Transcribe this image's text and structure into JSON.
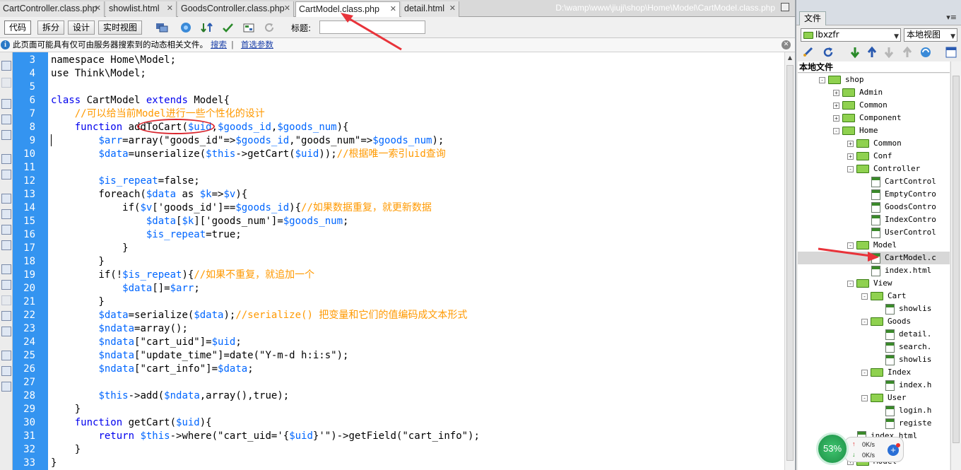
{
  "tabs": [
    {
      "label": "CartController.class.php",
      "active": false
    },
    {
      "label": "showlist.html",
      "active": false
    },
    {
      "label": "GoodsController.class.php",
      "active": false
    },
    {
      "label": "CartModel.class.php",
      "active": true
    },
    {
      "label": "detail.html",
      "active": false
    }
  ],
  "filepath": "D:\\wamp\\www\\jiuji\\shop\\Home\\Model\\CartModel.class.php",
  "toolbar": {
    "view_buttons": [
      "代码",
      "拆分",
      "设计",
      "实时视图"
    ],
    "title_label": "标题:",
    "title_value": ""
  },
  "infobar": {
    "text": "此页面可能具有仅可由服务器搜索到的动态相关文件。",
    "link1": "搜索",
    "sep": "|",
    "link2": "首选参数"
  },
  "code": {
    "lines": [
      {
        "n": "3",
        "segs": [
          [
            "namespace Home\\Model;",
            "st"
          ]
        ]
      },
      {
        "n": "4",
        "segs": [
          [
            "use Think\\Model;",
            "st"
          ]
        ]
      },
      {
        "n": "5",
        "segs": []
      },
      {
        "n": "6",
        "segs": [
          [
            "class",
            "kw"
          ],
          [
            " CartModel ",
            "st"
          ],
          [
            "extends",
            "kw"
          ],
          [
            " Model{",
            "st"
          ]
        ]
      },
      {
        "n": "7",
        "segs": [
          [
            "    //可以给当前Model进行一些个性化的设计",
            "cm"
          ]
        ]
      },
      {
        "n": "8",
        "segs": [
          [
            "    ",
            "st"
          ],
          [
            "function",
            "kw"
          ],
          [
            " addToCart(",
            "st"
          ],
          [
            "$uid",
            "vr"
          ],
          [
            ",",
            "st"
          ],
          [
            "$goods_id",
            "vr"
          ],
          [
            ",",
            "st"
          ],
          [
            "$goods_num",
            "vr"
          ],
          [
            "){",
            "st"
          ]
        ]
      },
      {
        "n": "9",
        "segs": [
          [
            "        ",
            "st"
          ],
          [
            "$arr",
            "vr"
          ],
          [
            "=array(\"goods_id\"=>",
            "st"
          ],
          [
            "$goods_id",
            "vr"
          ],
          [
            ",\"goods_num\"=>",
            "st"
          ],
          [
            "$goods_num",
            "vr"
          ],
          [
            ");",
            "st"
          ]
        ]
      },
      {
        "n": "10",
        "segs": [
          [
            "        ",
            "st"
          ],
          [
            "$data",
            "vr"
          ],
          [
            "=unserialize(",
            "st"
          ],
          [
            "$this",
            "vr"
          ],
          [
            "->getCart(",
            "st"
          ],
          [
            "$uid",
            "vr"
          ],
          [
            "));",
            "st"
          ],
          [
            "//根据唯一索引uid查询",
            "cm"
          ]
        ]
      },
      {
        "n": "11",
        "segs": []
      },
      {
        "n": "12",
        "segs": [
          [
            "        ",
            "st"
          ],
          [
            "$is_repeat",
            "vr"
          ],
          [
            "=false;",
            "st"
          ]
        ]
      },
      {
        "n": "13",
        "segs": [
          [
            "        foreach(",
            "st"
          ],
          [
            "$data",
            "vr"
          ],
          [
            " as ",
            "st"
          ],
          [
            "$k",
            "vr"
          ],
          [
            "=>",
            "st"
          ],
          [
            "$v",
            "vr"
          ],
          [
            "){",
            "st"
          ]
        ]
      },
      {
        "n": "14",
        "segs": [
          [
            "            if(",
            "st"
          ],
          [
            "$v",
            "vr"
          ],
          [
            "['goods_id']==",
            "st"
          ],
          [
            "$goods_id",
            "vr"
          ],
          [
            "){",
            "st"
          ],
          [
            "//如果数据重复，就更新数据",
            "cm"
          ]
        ]
      },
      {
        "n": "15",
        "segs": [
          [
            "                ",
            "st"
          ],
          [
            "$data",
            "vr"
          ],
          [
            "[",
            "st"
          ],
          [
            "$k",
            "vr"
          ],
          [
            "]['goods_num']=",
            "st"
          ],
          [
            "$goods_num",
            "vr"
          ],
          [
            ";",
            "st"
          ]
        ]
      },
      {
        "n": "16",
        "segs": [
          [
            "                ",
            "st"
          ],
          [
            "$is_repeat",
            "vr"
          ],
          [
            "=true;",
            "st"
          ]
        ]
      },
      {
        "n": "17",
        "segs": [
          [
            "            }",
            "st"
          ]
        ]
      },
      {
        "n": "18",
        "segs": [
          [
            "        }",
            "st"
          ]
        ]
      },
      {
        "n": "19",
        "segs": [
          [
            "        if(!",
            "st"
          ],
          [
            "$is_repeat",
            "vr"
          ],
          [
            "){",
            "st"
          ],
          [
            "//如果不重复，就追加一个",
            "cm"
          ]
        ]
      },
      {
        "n": "20",
        "segs": [
          [
            "            ",
            "st"
          ],
          [
            "$data",
            "vr"
          ],
          [
            "[]=",
            "st"
          ],
          [
            "$arr",
            "vr"
          ],
          [
            ";",
            "st"
          ]
        ]
      },
      {
        "n": "21",
        "segs": [
          [
            "        }",
            "st"
          ]
        ]
      },
      {
        "n": "22",
        "segs": [
          [
            "        ",
            "st"
          ],
          [
            "$data",
            "vr"
          ],
          [
            "=serialize(",
            "st"
          ],
          [
            "$data",
            "vr"
          ],
          [
            ");",
            "st"
          ],
          [
            "//serialize() 把变量和它们的值编码成文本形式",
            "cm"
          ]
        ]
      },
      {
        "n": "23",
        "segs": [
          [
            "        ",
            "st"
          ],
          [
            "$ndata",
            "vr"
          ],
          [
            "=array();",
            "st"
          ]
        ]
      },
      {
        "n": "24",
        "segs": [
          [
            "        ",
            "st"
          ],
          [
            "$ndata",
            "vr"
          ],
          [
            "[\"cart_uid\"]=",
            "st"
          ],
          [
            "$uid",
            "vr"
          ],
          [
            ";",
            "st"
          ]
        ]
      },
      {
        "n": "25",
        "segs": [
          [
            "        ",
            "st"
          ],
          [
            "$ndata",
            "vr"
          ],
          [
            "[\"update_time\"]=date(\"Y-m-d h:i:s\");",
            "st"
          ]
        ]
      },
      {
        "n": "26",
        "segs": [
          [
            "        ",
            "st"
          ],
          [
            "$ndata",
            "vr"
          ],
          [
            "[\"cart_info\"]=",
            "st"
          ],
          [
            "$data",
            "vr"
          ],
          [
            ";",
            "st"
          ]
        ]
      },
      {
        "n": "27",
        "segs": []
      },
      {
        "n": "28",
        "segs": [
          [
            "        ",
            "st"
          ],
          [
            "$this",
            "vr"
          ],
          [
            "->add(",
            "st"
          ],
          [
            "$ndata",
            "vr"
          ],
          [
            ",array(),true);",
            "st"
          ]
        ]
      },
      {
        "n": "29",
        "segs": [
          [
            "    }",
            "st"
          ]
        ]
      },
      {
        "n": "30",
        "segs": [
          [
            "    ",
            "st"
          ],
          [
            "function",
            "kw"
          ],
          [
            " getCart(",
            "st"
          ],
          [
            "$uid",
            "vr"
          ],
          [
            "){",
            "st"
          ]
        ]
      },
      {
        "n": "31",
        "segs": [
          [
            "        ",
            "st"
          ],
          [
            "return",
            "kw"
          ],
          [
            " ",
            "st"
          ],
          [
            "$this",
            "vr"
          ],
          [
            "->where(\"cart_uid='{",
            "st"
          ],
          [
            "$uid",
            "vr"
          ],
          [
            "}'\")->getField(\"cart_info\");",
            "st"
          ]
        ]
      },
      {
        "n": "32",
        "segs": [
          [
            "    }",
            "st"
          ]
        ]
      },
      {
        "n": "33",
        "segs": [
          [
            "}",
            "st"
          ]
        ]
      }
    ]
  },
  "panel": {
    "tab": "文件",
    "site_select": "lbxzfr",
    "view_select": "本地视图",
    "tree_header": "本地文件",
    "tree": [
      {
        "label": "shop",
        "depth": 0,
        "type": "folder",
        "exp": "-"
      },
      {
        "label": "Admin",
        "depth": 1,
        "type": "folder",
        "exp": "+"
      },
      {
        "label": "Common",
        "depth": 1,
        "type": "folder",
        "exp": "+"
      },
      {
        "label": "Component",
        "depth": 1,
        "type": "folder",
        "exp": "+"
      },
      {
        "label": "Home",
        "depth": 1,
        "type": "folder",
        "exp": "-"
      },
      {
        "label": "Common",
        "depth": 2,
        "type": "folder",
        "exp": "+"
      },
      {
        "label": "Conf",
        "depth": 2,
        "type": "folder",
        "exp": "+"
      },
      {
        "label": "Controller",
        "depth": 2,
        "type": "folder",
        "exp": "-"
      },
      {
        "label": "CartControl",
        "depth": 3,
        "type": "file"
      },
      {
        "label": "EmptyContro",
        "depth": 3,
        "type": "file"
      },
      {
        "label": "GoodsContro",
        "depth": 3,
        "type": "file"
      },
      {
        "label": "IndexContro",
        "depth": 3,
        "type": "file"
      },
      {
        "label": "UserControl",
        "depth": 3,
        "type": "file"
      },
      {
        "label": "Model",
        "depth": 2,
        "type": "folder",
        "exp": "-"
      },
      {
        "label": "CartModel.c",
        "depth": 3,
        "type": "file",
        "selected": true
      },
      {
        "label": "index.html",
        "depth": 3,
        "type": "file"
      },
      {
        "label": "View",
        "depth": 2,
        "type": "folder",
        "exp": "-"
      },
      {
        "label": "Cart",
        "depth": 3,
        "type": "folder",
        "exp": "-"
      },
      {
        "label": "showlis",
        "depth": 4,
        "type": "file"
      },
      {
        "label": "Goods",
        "depth": 3,
        "type": "folder",
        "exp": "-"
      },
      {
        "label": "detail.",
        "depth": 4,
        "type": "file"
      },
      {
        "label": "search.",
        "depth": 4,
        "type": "file"
      },
      {
        "label": "showlis",
        "depth": 4,
        "type": "file"
      },
      {
        "label": "Index",
        "depth": 3,
        "type": "folder",
        "exp": "-"
      },
      {
        "label": "index.h",
        "depth": 4,
        "type": "file"
      },
      {
        "label": "User",
        "depth": 3,
        "type": "folder",
        "exp": "-"
      },
      {
        "label": "login.h",
        "depth": 4,
        "type": "file"
      },
      {
        "label": "registe",
        "depth": 4,
        "type": "file"
      },
      {
        "label": "index.html",
        "depth": 2,
        "type": "file"
      },
      {
        "label": "x.html",
        "depth": 2,
        "type": "file"
      },
      {
        "label": "Model",
        "depth": 2,
        "type": "folder",
        "exp": "+"
      }
    ]
  },
  "network": {
    "percent": "53%",
    "up": "0K/s",
    "down": "0K/s",
    "plus": "+"
  },
  "colors": {
    "gutter": "#3494f0",
    "keyword": "#0000ee",
    "variable": "#0066ff",
    "comment": "#ff9900",
    "annotation": "#d9262e"
  }
}
